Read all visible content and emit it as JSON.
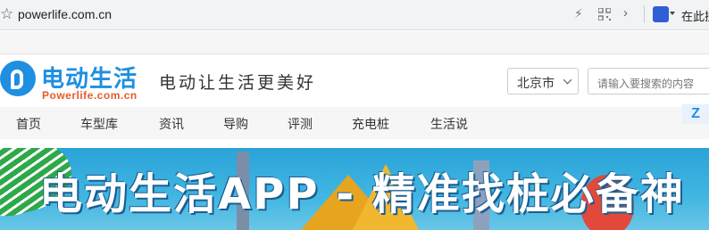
{
  "browser": {
    "url": "powerlife.com.cn",
    "search_label": "在此搜"
  },
  "site": {
    "logo_title": "电动生活",
    "logo_subtitle": "Powerlife.com.cn",
    "slogan": "电动让生活更美好",
    "city": "北京市",
    "search_placeholder": "请输入要搜索的内容"
  },
  "nav": {
    "items": [
      "首页",
      "车型库",
      "资讯",
      "导购",
      "评测",
      "充电桩",
      "生活说"
    ]
  },
  "banner": {
    "text": "电动生活APP - 精准找桩必备神"
  },
  "colors": {
    "brand_blue": "#1e8fe1",
    "brand_orange": "#e85a2c"
  }
}
